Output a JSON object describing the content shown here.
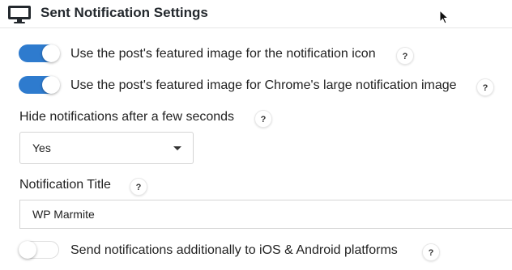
{
  "header": {
    "title": "Sent Notification Settings",
    "icon": "monitor-icon"
  },
  "settings": {
    "featured_icon": {
      "label": "Use the post's featured image for the notification icon",
      "enabled": true,
      "help": "?"
    },
    "featured_large_image": {
      "label": "Use the post's featured image for Chrome's large notification image",
      "enabled": true,
      "help": "?"
    },
    "hide_after": {
      "label": "Hide notifications after a few seconds",
      "help": "?",
      "selected": "Yes"
    },
    "notification_title": {
      "label": "Notification Title",
      "help": "?",
      "value": "WP Marmite"
    },
    "send_ios_android": {
      "label": "Send notifications additionally to iOS & Android platforms",
      "enabled": false,
      "help": "?"
    }
  },
  "colors": {
    "toggle_on": "#2e7bce",
    "toggle_off_border": "#dcdcdc",
    "divider": "#e6e6e6"
  }
}
